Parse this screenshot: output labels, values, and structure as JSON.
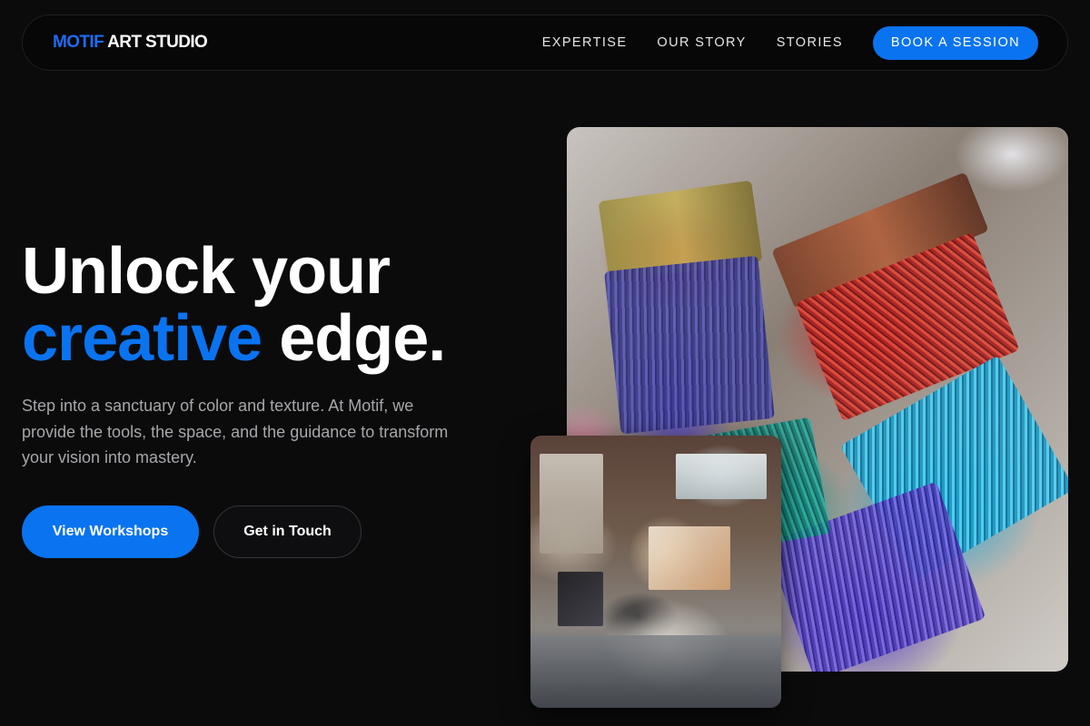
{
  "nav": {
    "logo_accent": "MOTIF",
    "logo_rest": " ART STUDIO",
    "links": [
      "EXPERTISE",
      "OUR STORY",
      "STORIES"
    ],
    "cta": "BOOK A SESSION"
  },
  "hero": {
    "title_line1": "Unlock your",
    "title_accent": "creative",
    "title_line2_rest": " edge.",
    "description": "Step into a sanctuary of color and texture. At Motif, we provide the tools, the space, and the guidance to transform your vision into mastery.",
    "primary_button": "View Workshops",
    "secondary_button": "Get in Touch"
  },
  "colors": {
    "accent": "#0a73f0",
    "background": "#0b0b0c"
  },
  "icons": {
    "main_image": "paintbrushes-photo",
    "secondary_image": "art-studio-photo"
  }
}
